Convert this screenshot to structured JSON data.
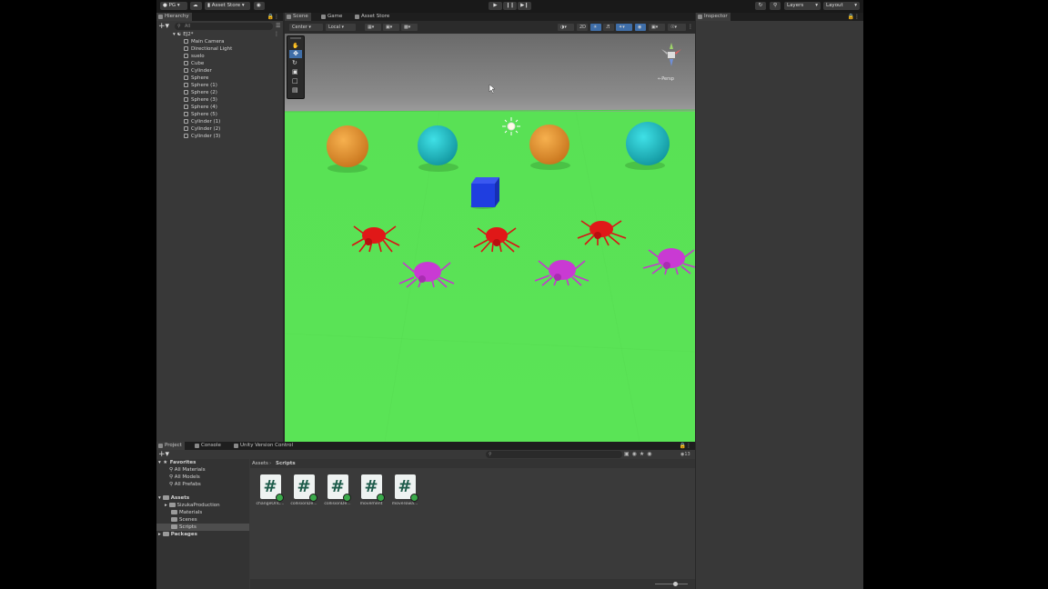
{
  "toolbar": {
    "account": "PG",
    "asset_store": "Asset Store",
    "layers": "Layers",
    "layout": "Layout"
  },
  "hierarchy": {
    "tab": "Hierarchy",
    "search_placeholder": "All",
    "scene_name": "EJ2*",
    "items": [
      "Main Camera",
      "Directional Light",
      "suelo",
      "Cube",
      "Cylinder",
      "Sphere",
      "Sphere (1)",
      "Sphere (2)",
      "Sphere (3)",
      "Sphere (4)",
      "Sphere (5)",
      "Cylinder (1)",
      "Cylinder (2)",
      "Cylinder (3)"
    ]
  },
  "scene": {
    "tabs": [
      "Scene",
      "Game",
      "Asset Store"
    ],
    "pivot": "Center",
    "space": "Local",
    "persp": "←Persp"
  },
  "inspector": {
    "tab": "Inspector"
  },
  "project": {
    "tabs": [
      "Project",
      "Console",
      "Unity Version Control"
    ],
    "favorites_label": "Favorites",
    "favorites": [
      "All Materials",
      "All Models",
      "All Prefabs"
    ],
    "assets_label": "Assets",
    "assets": [
      "SizukaProduction",
      "Materials",
      "Scenes",
      "Scripts"
    ],
    "packages_label": "Packages",
    "breadcrumb": [
      "Assets",
      "Scripts"
    ],
    "count": "13",
    "scripts": [
      "changeOnC...",
      "collisionDe...",
      "collisionDe...",
      "movement",
      "moveTowa..."
    ]
  },
  "colors": {
    "ground": "#5ae456",
    "orange_sphere": "#e8962e",
    "cyan_sphere": "#1fc3cc",
    "cube": "#1f3ee0",
    "red_spider": "#e01818",
    "magenta_spider": "#c93ad3"
  }
}
